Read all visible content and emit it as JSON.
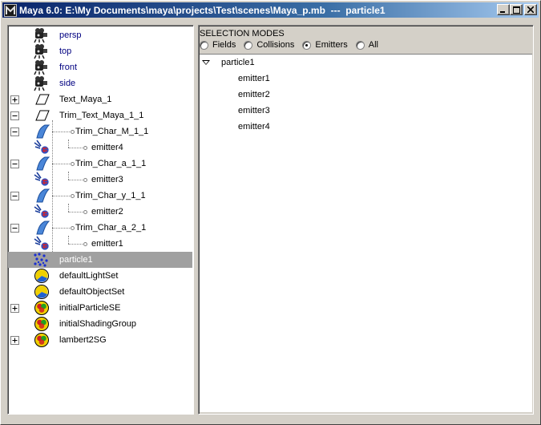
{
  "window": {
    "title": "Maya 6.0: E:\\My Documents\\maya\\projects\\Test\\scenes\\Maya_p.mb  ---  particle1"
  },
  "outliner": {
    "items": [
      {
        "label": "persp",
        "kind": "camera",
        "camera": true
      },
      {
        "label": "top",
        "kind": "camera",
        "camera": true
      },
      {
        "label": "front",
        "kind": "camera",
        "camera": true
      },
      {
        "label": "side",
        "kind": "camera",
        "camera": true
      },
      {
        "label": "Text_Maya_1",
        "kind": "text",
        "expander": "plus"
      },
      {
        "label": "Trim_Text_Maya_1_1",
        "kind": "text",
        "expander": "minus"
      },
      {
        "label": "Trim_Char_M_1_1",
        "kind": "surface",
        "expander": "minus"
      },
      {
        "label": "emitter4",
        "kind": "emitter-child"
      },
      {
        "label": "Trim_Char_a_1_1",
        "kind": "surface",
        "expander": "minus"
      },
      {
        "label": "emitter3",
        "kind": "emitter-child"
      },
      {
        "label": "Trim_Char_y_1_1",
        "kind": "surface",
        "expander": "minus"
      },
      {
        "label": "emitter2",
        "kind": "emitter-child"
      },
      {
        "label": "Trim_Char_a_2_1",
        "kind": "surface",
        "expander": "minus"
      },
      {
        "label": "emitter1",
        "kind": "emitter-child"
      },
      {
        "label": "particle1",
        "kind": "particle",
        "selected": true
      },
      {
        "label": "defaultLightSet",
        "kind": "set-light"
      },
      {
        "label": "defaultObjectSet",
        "kind": "set-light"
      },
      {
        "label": "initialParticleSE",
        "kind": "set-shading",
        "expander": "plus"
      },
      {
        "label": "initialShadingGroup",
        "kind": "set-shading"
      },
      {
        "label": "lambert2SG",
        "kind": "set-shading",
        "expander": "plus"
      }
    ]
  },
  "selection_modes": {
    "header": "SELECTION MODES",
    "options": [
      {
        "label": "Fields",
        "checked": false
      },
      {
        "label": "Collisions",
        "checked": false
      },
      {
        "label": "Emitters",
        "checked": true
      },
      {
        "label": "All",
        "checked": false
      }
    ]
  },
  "relationship_list": {
    "parent": "particle1",
    "children": [
      "emitter1",
      "emitter2",
      "emitter3",
      "emitter4"
    ]
  },
  "colors": {
    "title_start": "#0a246a",
    "title_end": "#a6caf0",
    "selection": "#a0a0a0",
    "camera_text": "#000080"
  }
}
